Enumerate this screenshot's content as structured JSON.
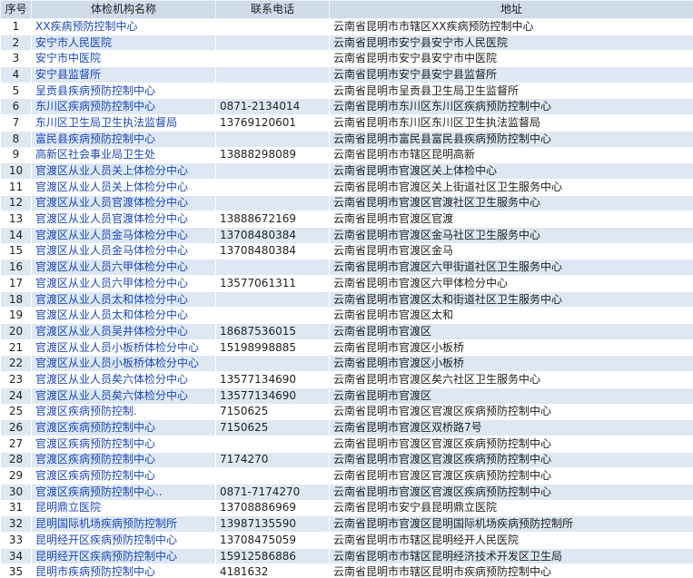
{
  "headers": {
    "no": "序号",
    "name": "体检机构名称",
    "phone": "联系电话",
    "address": "地址"
  },
  "rows": [
    {
      "no": "1",
      "name": "XX疾病预防控制中心",
      "phone": "",
      "address": "云南省昆明市市辖区XX疾病预防控制中心"
    },
    {
      "no": "2",
      "name": "安宁市人民医院",
      "phone": "",
      "address": "云南省昆明市安宁县安宁市人民医院"
    },
    {
      "no": "3",
      "name": "安宁市中医院",
      "phone": "",
      "address": "云南省昆明市安宁县安宁市中医院"
    },
    {
      "no": "4",
      "name": "安宁县监督所",
      "phone": "",
      "address": "云南省昆明市安宁县安宁县监督所"
    },
    {
      "no": "5",
      "name": "呈贡县疾病预防控制中心",
      "phone": "",
      "address": "云南省昆明市呈贡县卫生局卫生监督所"
    },
    {
      "no": "6",
      "name": "东川区疾病预防控制中心",
      "phone": "0871-2134014",
      "address": "云南省昆明市东川区东川区疾病预防控制中心"
    },
    {
      "no": "7",
      "name": "东川区卫生局卫生执法监督局",
      "phone": "13769120601",
      "address": "云南省昆明市东川区东川区卫生执法监督局"
    },
    {
      "no": "8",
      "name": "富民县疾病预防控制中心",
      "phone": "",
      "address": "云南省昆明市富民县富民县疾病预防控制中心"
    },
    {
      "no": "9",
      "name": "高新区社会事业局卫生处",
      "phone": "13888298089",
      "address": "云南省昆明市市辖区昆明高新"
    },
    {
      "no": "10",
      "name": "官渡区从业人员关上体检分中心",
      "phone": "",
      "address": "云南省昆明市官渡区关上体检中心"
    },
    {
      "no": "11",
      "name": "官渡区从业人员关上体检分中心",
      "phone": "",
      "address": "云南省昆明市官渡区关上街道社区卫生服务中心"
    },
    {
      "no": "12",
      "name": "官渡区从业人员官渡体检分中心",
      "phone": "",
      "address": "云南省昆明市官渡区官渡社区卫生服务中心"
    },
    {
      "no": "13",
      "name": "官渡区从业人员官渡体检分中心",
      "phone": "13888672169",
      "address": "云南省昆明市官渡区官渡"
    },
    {
      "no": "14",
      "name": "官渡区从业人员金马体检分中心",
      "phone": "13708480384",
      "address": "云南省昆明市官渡区金马社区卫生服务中心"
    },
    {
      "no": "15",
      "name": "官渡区从业人员金马体检分中心",
      "phone": "13708480384",
      "address": "云南省昆明市官渡区金马"
    },
    {
      "no": "16",
      "name": "官渡区从业人员六甲体检分中心",
      "phone": "",
      "address": "云南省昆明市官渡区六甲街道社区卫生服务中心"
    },
    {
      "no": "17",
      "name": "官渡区从业人员六甲体检分中心",
      "phone": "13577061311",
      "address": "云南省昆明市官渡区六甲体检分中心"
    },
    {
      "no": "18",
      "name": "官渡区从业人员太和体检分中心",
      "phone": "",
      "address": "云南省昆明市官渡区太和街道社区卫生服务中心"
    },
    {
      "no": "19",
      "name": "官渡区从业人员太和体检分中心",
      "phone": "",
      "address": "云南省昆明市官渡区太和"
    },
    {
      "no": "20",
      "name": "官渡区从业人员吴井体检分中心",
      "phone": "18687536015",
      "address": "云南省昆明市官渡区"
    },
    {
      "no": "21",
      "name": "官渡区从业人员小板桥体检分中心",
      "phone": "15198998885",
      "address": "云南省昆明市官渡区小板桥"
    },
    {
      "no": "22",
      "name": "官渡区从业人员小板桥体检分中心",
      "phone": "",
      "address": "云南省昆明市官渡区小板桥"
    },
    {
      "no": "23",
      "name": "官渡区从业人员矣六体检分中心",
      "phone": "13577134690",
      "address": "云南省昆明市官渡区矣六社区卫生服务中心"
    },
    {
      "no": "24",
      "name": "官渡区从业人员矣六体检分中心",
      "phone": "13577134690",
      "address": "云南省昆明市官渡区"
    },
    {
      "no": "25",
      "name": "官渡区疾病预防控制.",
      "phone": "7150625",
      "address": "云南省昆明市官渡区官渡区疾病预防控制中心"
    },
    {
      "no": "26",
      "name": "官渡区疾病预防控制中心",
      "phone": "7150625",
      "address": "云南省昆明市官渡区双桥路7号"
    },
    {
      "no": "27",
      "name": "官渡区疾病预防控制中心",
      "phone": "",
      "address": "云南省昆明市官渡区官渡区疾病预防控制中心"
    },
    {
      "no": "28",
      "name": "官渡区疾病预防控制中心",
      "phone": "7174270",
      "address": "云南省昆明市官渡区官渡区疾病预防控制中心"
    },
    {
      "no": "29",
      "name": "官渡区疾病预防控制中心",
      "phone": "",
      "address": "云南省昆明市官渡区官渡区疾病预防控制中心"
    },
    {
      "no": "30",
      "name": "官渡区疾病预防控制中心..",
      "phone": "0871-7174270",
      "address": "云南省昆明市官渡区官渡区疾病预防控制中心"
    },
    {
      "no": "31",
      "name": "昆明鼎立医院",
      "phone": "13708886969",
      "address": "云南省昆明市安宁县昆明鼎立医院"
    },
    {
      "no": "32",
      "name": "昆明国际机场疾病预防控制所",
      "phone": "13987135590",
      "address": "云南省昆明市官渡区昆明国际机场疾病预防控制所"
    },
    {
      "no": "33",
      "name": "昆明经开区疾病预防控制中心",
      "phone": "13708475059",
      "address": "云南省昆明市市辖区昆明经开人民医院"
    },
    {
      "no": "34",
      "name": "昆明经开区疾病预防控制中心",
      "phone": "15912586886",
      "address": "云南省昆明市市辖区昆明经济技术开发区卫生局"
    },
    {
      "no": "35",
      "name": "昆明市疾病预防控制中心",
      "phone": "4181632",
      "address": "云南省昆明市市辖区昆明市疾病预防控制中心"
    }
  ]
}
